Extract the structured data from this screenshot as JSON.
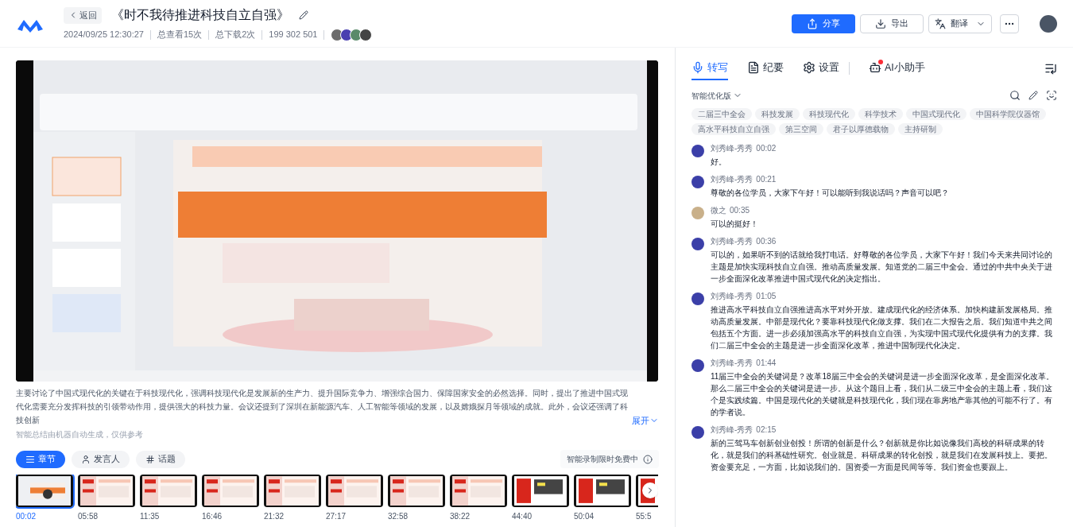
{
  "header": {
    "back": "返回",
    "title": "《时不我待推进科技自立自强》",
    "meta": [
      "2024/09/25 12:30:27",
      "总查看15次",
      "总下载2次",
      "199 302 501"
    ],
    "actions": [
      {
        "label": "分享",
        "kind": "primary"
      },
      {
        "label": "导出",
        "kind": "export"
      },
      {
        "label": "翻译",
        "kind": "translate"
      }
    ]
  },
  "summary": {
    "text": "主要讨论了中国式现代化的关键在于科技现代化，强调科技现代化是发展新的生产力、提升国际竞争力、增强综合国力、保障国家安全的必然选择。同时，提出了推进中国式现代化需要充分发挥科技的引领带动作用，提供强大的科技力量。会议还提到了深圳在新能源汽车、人工智能等领域的发展，以及嫦娥探月等领域的成就。此外，会议还强调了科技创新",
    "expand": "展开",
    "note": "智能总结由机器自动生成，仅供参考"
  },
  "chapter_tabs": [
    {
      "label": "章节",
      "selected": true
    },
    {
      "label": "发言人",
      "selected": false
    },
    {
      "label": "话题",
      "selected": false
    }
  ],
  "recording_note": "智能录制限时免费中",
  "chapters": [
    {
      "time": "00:02",
      "selected": true
    },
    {
      "time": "05:58",
      "selected": false
    },
    {
      "time": "11:35",
      "selected": false
    },
    {
      "time": "16:46",
      "selected": false
    },
    {
      "time": "21:32",
      "selected": false
    },
    {
      "time": "27:17",
      "selected": false
    },
    {
      "time": "32:58",
      "selected": false
    },
    {
      "time": "38:22",
      "selected": false
    },
    {
      "time": "44:40",
      "selected": false
    },
    {
      "time": "50:04",
      "selected": false
    },
    {
      "time": "55:5",
      "selected": false
    }
  ],
  "panel_tabs": [
    {
      "label": "转写",
      "selected": true,
      "kind": "transcript"
    },
    {
      "label": "纪要",
      "selected": false,
      "kind": "minutes"
    },
    {
      "label": "设置",
      "selected": false,
      "kind": "settings"
    },
    {
      "label": "AI小助手",
      "selected": false,
      "kind": "assistant"
    }
  ],
  "version": "智能优化版",
  "tags": [
    "二届三中全会",
    "科技发展",
    "科技现代化",
    "科学技术",
    "中国式现代化",
    "中国科学院仪器馆",
    "高水平科技自立自强",
    "第三空间",
    "君子以厚德载物",
    "主持研制"
  ],
  "transcript": [
    {
      "speaker": "刘秀峰-秀秀",
      "time": "00:02",
      "text": "好。",
      "color": "#3b3fa8"
    },
    {
      "speaker": "刘秀峰-秀秀",
      "time": "00:21",
      "text": "尊敬的各位学员，大家下午好！可以能听到我说话吗？声音可以吧？",
      "color": "#3b3fa8"
    },
    {
      "speaker": "微之",
      "time": "00:35",
      "text": "可以的挺好！",
      "color": "#c9b08a"
    },
    {
      "speaker": "刘秀峰-秀秀",
      "time": "00:36",
      "text": "可以的，如果听不到的话就给我打电话。好尊敬的各位学员，大家下午好！我们今天来共同讨论的主题是加快实现科技自立自强。推动高质量发展。知道党的二届三中全会。通过的中共中央关于进一步全面深化改革推进中国式现代化的决定指出。",
      "color": "#3b3fa8"
    },
    {
      "speaker": "刘秀峰-秀秀",
      "time": "01:05",
      "text": "推进高水平科技自立自强推进高水平对外开放。建成现代化的经济体系。加快构建新发展格局。推动高质量发展。中部是现代化？要靠科技现代化做支撑。我们在二大报告之后。我们知道中共之间包括五个方面。进一步必须加强高水平的科技自立自强，为实现中国式现代化提供有力的支撑。我们二届三中全会的主题是进一步全面深化改革，推进中国制现代化决定。",
      "color": "#3b3fa8"
    },
    {
      "speaker": "刘秀峰-秀秀",
      "time": "01:44",
      "text": "11届三中全会的关键词是？改革18届三中全会的关键词是进一步全面深化改革，是全面深化改革。那么二届三中全会的关键词是进一步。从这个题目上看，我们从二级三中全会的主题上看，我们这个是实践续篇。中国是现代化的关键就是科技现代化，我们现在靠房地产靠其他的可能不行了。有的学者说。",
      "color": "#3b3fa8"
    },
    {
      "speaker": "刘秀峰-秀秀",
      "time": "02:15",
      "text": "新的三驾马车创新创业创投！所谓的创新是什么？创新就是你比如说像我们高校的科研成果的转化，就是我们的科基础性研究。创业就是。科研成果的转化创投，就是我们在发展科技上。要把。资金要充足，一方面，比如说我们的。国资委一方面是民间等等。我们资金也要跟上。",
      "color": "#3b3fa8"
    }
  ]
}
